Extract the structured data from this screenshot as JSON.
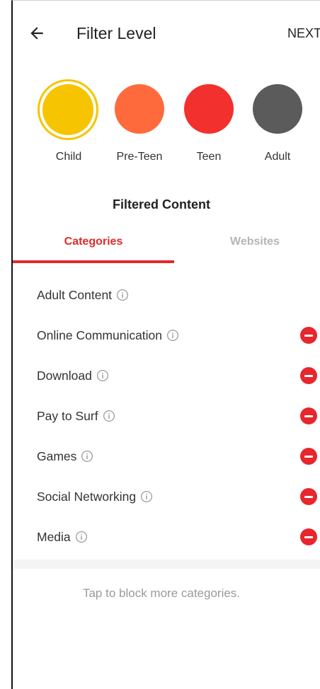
{
  "header": {
    "title": "Filter Level",
    "next_label": "NEXT"
  },
  "levels": [
    {
      "label": "Child",
      "color": "#f6c400",
      "selected": true
    },
    {
      "label": "Pre-Teen",
      "color": "#ff6a3d",
      "selected": false
    },
    {
      "label": "Teen",
      "color": "#f2302e",
      "selected": false
    },
    {
      "label": "Adult",
      "color": "#5b5b5b",
      "selected": false
    }
  ],
  "section_title": "Filtered Content",
  "tabs": [
    {
      "label": "Categories",
      "active": true
    },
    {
      "label": "Websites",
      "active": false
    }
  ],
  "categories": [
    {
      "name": "Adult Content",
      "removable": false
    },
    {
      "name": "Online Communication",
      "removable": true
    },
    {
      "name": "Download",
      "removable": true
    },
    {
      "name": "Pay to Surf",
      "removable": true
    },
    {
      "name": "Games",
      "removable": true
    },
    {
      "name": "Social Networking",
      "removable": true
    },
    {
      "name": "Media",
      "removable": true
    }
  ],
  "hint": "Tap to block more categories.",
  "colors": {
    "accent": "#e22a2a",
    "remove": "#e8262d",
    "selected_ring": "#f6c400"
  },
  "icons": {
    "back": "arrow-left-icon",
    "info": "info-circle-icon",
    "remove": "minus-circle-icon"
  }
}
